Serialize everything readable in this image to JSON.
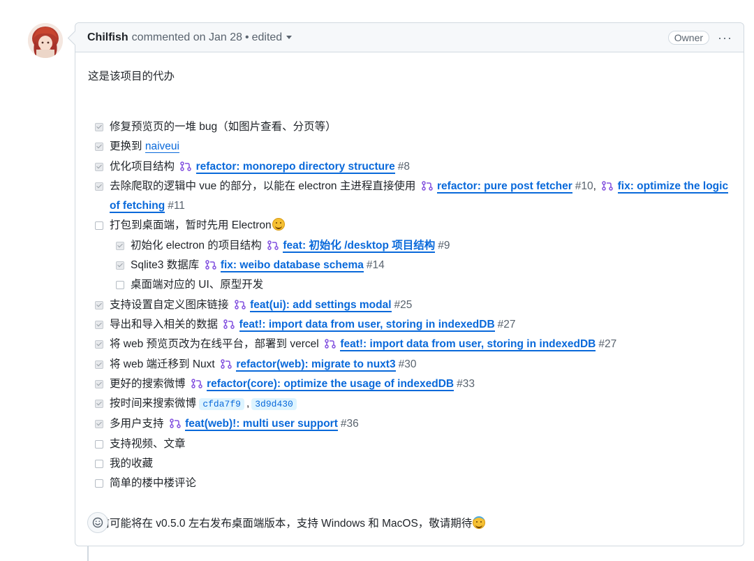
{
  "header": {
    "author": "Chilfish",
    "action": "commented on Jan 28",
    "separator": "•",
    "edited": "edited",
    "badge": "Owner",
    "more": "···"
  },
  "body": {
    "intro": "这是该项目的代办",
    "outro": "目前可能将在 v0.5.0 左右发布桌面端版本，支持 Windows 和 MacOS，敬请期待"
  },
  "tasks": [
    {
      "text": "修复预览页的一堆 bug（如图片查看、分页等）"
    },
    {
      "text": "更换到",
      "link": "naiveui"
    },
    {
      "text": "优化项目结构",
      "pr": "refactor: monorepo directory structure",
      "num": "#8"
    },
    {
      "text": "去除爬取的逻辑中 vue 的部分，以能在 electron 主进程直接使用",
      "pr": "refactor: pure post fetcher",
      "num": "#10",
      "sep": ",",
      "pr2": "fix: optimize the logic of fetching",
      "num2": "#11"
    },
    {
      "text": "打包到桌面端，暂时先用 Electron"
    },
    {
      "text": "初始化 electron 的项目结构",
      "pr": "feat: 初始化 /desktop 项目结构",
      "num": "#9"
    },
    {
      "text": "Sqlite3 数据库",
      "pr": "fix: weibo database schema",
      "num": "#14"
    },
    {
      "text": "桌面端对应的 UI、原型开发"
    },
    {
      "text": "支持设置自定义图床链接",
      "pr": "feat(ui): add settings modal",
      "num": "#25"
    },
    {
      "text": "导出和导入相关的数据",
      "pr": "feat!: import data from user, storing in indexedDB",
      "num": "#27"
    },
    {
      "text": "将 web 预览页改为在线平台，部署到 vercel",
      "pr": "feat!: import data from user, storing in indexedDB",
      "num": "#27"
    },
    {
      "text": "将 web 端迁移到 Nuxt",
      "pr": "refactor(web): migrate to nuxt3",
      "num": "#30"
    },
    {
      "text": "更好的搜索微博",
      "pr": "refactor(core): optimize the usage of indexedDB",
      "num": "#33"
    },
    {
      "text": "按时间来搜索微博",
      "sha1": "cfda7f9",
      "sep": ",",
      "sha2": "3d9d430"
    },
    {
      "text": "多用户支持",
      "pr": "feat(web)!: multi user support",
      "num": "#36"
    },
    {
      "text": "支持视频、文章"
    },
    {
      "text": "我的收藏"
    },
    {
      "text": "简单的楼中楼评论"
    }
  ],
  "colors": {
    "link": "#0969da",
    "border": "#d1d9e0",
    "header_bg": "#f6f8fa",
    "muted": "#59636e"
  },
  "icons": {
    "pr": "git-pull-request-icon",
    "reaction": "smiley-icon",
    "emoji_grin": "grinning-sweat-emoji",
    "emoji_halo": "smiling-halo-emoji"
  }
}
